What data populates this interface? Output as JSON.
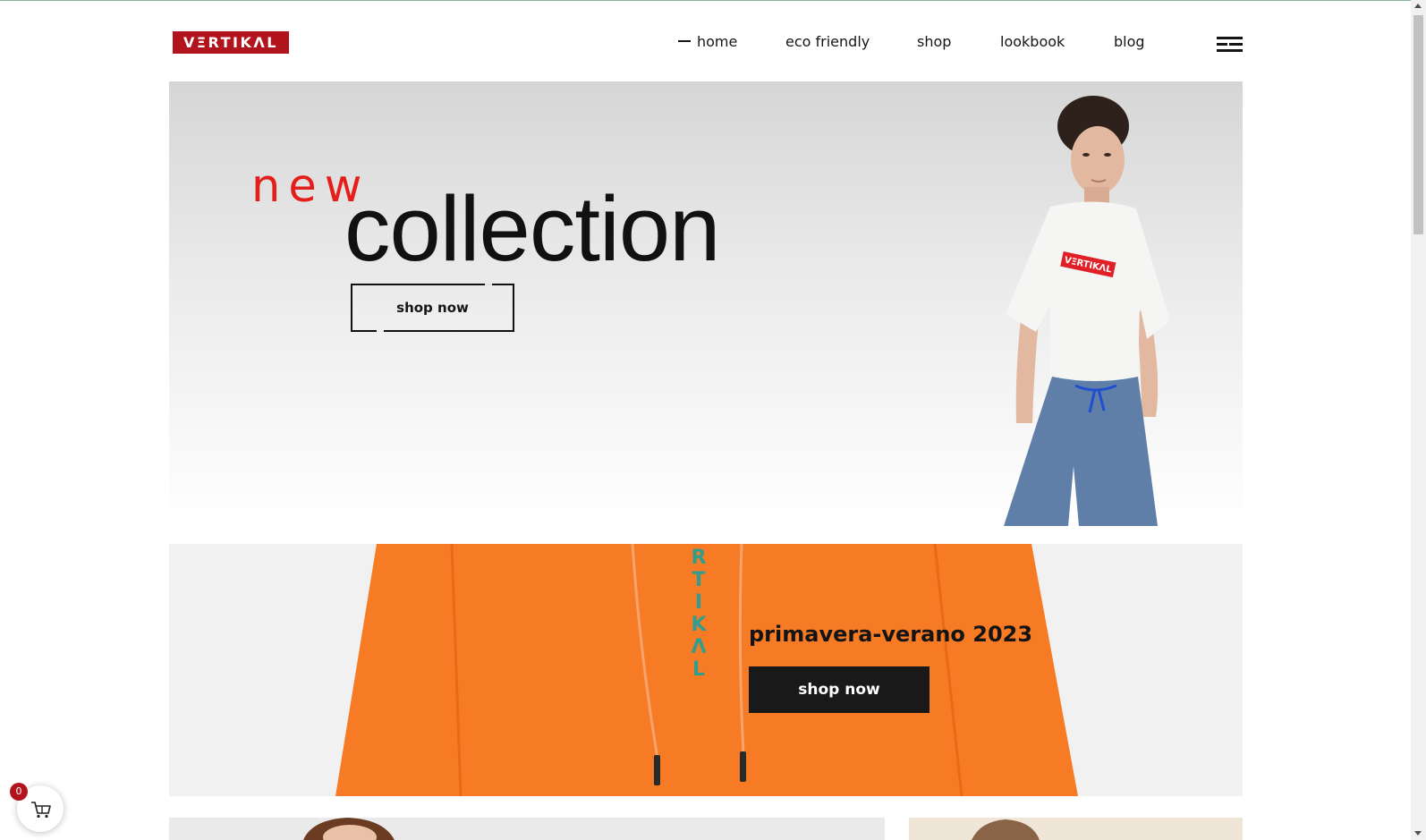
{
  "brand": {
    "logo_text": "VΞRTIKΛL"
  },
  "nav": {
    "items": [
      {
        "label": "home",
        "active": true
      },
      {
        "label": "eco friendly"
      },
      {
        "label": "shop"
      },
      {
        "label": "lookbook"
      },
      {
        "label": "blog"
      }
    ],
    "menu_icon": "hamburger-menu-icon"
  },
  "hero": {
    "accent_word": "new",
    "headline": "collection",
    "cta_label": "shop now",
    "shirt_logo": "VΞRTIKΛL"
  },
  "promo": {
    "title": "primavera-verano 2023",
    "cta_label": "shop now",
    "hoodie_print": [
      "R",
      "T",
      "I",
      "K",
      "Λ",
      "L"
    ]
  },
  "cart": {
    "count": "0",
    "icon": "shopping-cart-icon"
  },
  "colors": {
    "brand_red": "#b2141d",
    "accent_red": "#e41f1b",
    "hoodie_orange": "#f77a25",
    "text_dark": "#151515"
  }
}
